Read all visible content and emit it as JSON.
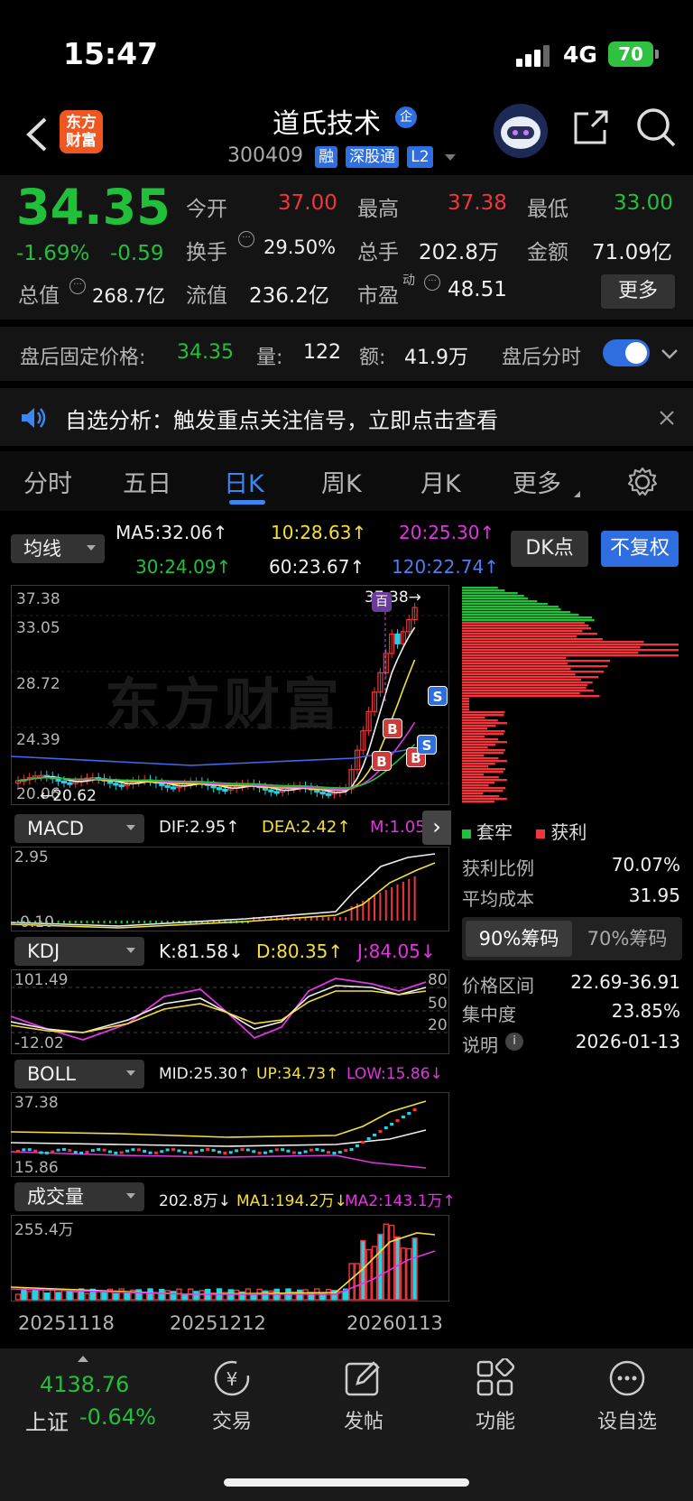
{
  "status": {
    "time": "15:47",
    "network": "4G",
    "battery": "70"
  },
  "header": {
    "logo_text": "东方\n财富",
    "title": "道氏技术",
    "title_badge": "企",
    "code": "300409",
    "tags": [
      "融",
      "深股通",
      "L2"
    ]
  },
  "quote": {
    "price": "34.35",
    "change_pct": "-1.69%",
    "change": "-0.59",
    "open_label": "今开",
    "open": "37.00",
    "high_label": "最高",
    "high": "37.38",
    "low_label": "最低",
    "low": "33.00",
    "turnover_label": "换手",
    "turnover": "29.50%",
    "volume_label": "总手",
    "volume": "202.8万",
    "amount_label": "金额",
    "amount": "71.09亿",
    "mktcap_label": "总值",
    "mktcap": "268.7亿",
    "float_label": "流值",
    "float": "236.2亿",
    "pe_label": "市盈",
    "pe_sup": "动",
    "pe": "48.51",
    "more_button": "更多"
  },
  "afterhours": {
    "label": "盘后固定价格:",
    "price": "34.35",
    "vol_label": "量:",
    "vol": "122",
    "amt_label": "额:",
    "amt": "41.9万",
    "toggle_label": "盘后分时",
    "toggle_on": true
  },
  "notice": {
    "text": "自选分析：触发重点关注信号，立即点击查看"
  },
  "tabs": [
    {
      "label": "分时"
    },
    {
      "label": "五日"
    },
    {
      "label": "日K"
    },
    {
      "label": "周K"
    },
    {
      "label": "月K"
    },
    {
      "label": "更多"
    }
  ],
  "active_tab": "日K",
  "ma": {
    "selector": "均线",
    "ma5": "MA5:32.06↑",
    "ma10": "10:28.63↑",
    "ma20": "20:25.30↑",
    "ma30": "30:24.09↑",
    "ma60": "60:23.67↑",
    "ma120": "120:22.74↑",
    "dk_button": "DK点",
    "fq_button": "不复权"
  },
  "kchart": {
    "y_labels": [
      "37.38",
      "33.05",
      "28.72",
      "24.39",
      "20.06"
    ],
    "max_annot": "37.38→",
    "min_annot": "←20.62",
    "watermark": "东方财富",
    "marker_top": "百",
    "b_markers": [
      "B",
      "B",
      "B"
    ],
    "s_markers": [
      "S",
      "S"
    ]
  },
  "macd": {
    "selector": "MACD",
    "dif": "DIF:2.95↑",
    "dea": "DEA:2.42↑",
    "m": "M:1.05↑",
    "y_top": "2.95",
    "y_bottom": "-0.10"
  },
  "kdj": {
    "selector": "KDJ",
    "k": "K:81.58↓",
    "d": "D:80.35↑",
    "j": "J:84.05↓",
    "y_top": "101.49",
    "y_bottom": "-12.02",
    "levels": [
      "80",
      "50",
      "20"
    ]
  },
  "boll": {
    "selector": "BOLL",
    "mid": "MID:25.30↑",
    "up": "UP:34.73↑",
    "low": "LOW:15.86↓",
    "y_top": "37.38",
    "y_bottom": "15.86"
  },
  "vol": {
    "selector": "成交量",
    "v": "202.8万↓",
    "ma1": "MA1:194.2万↓",
    "ma2": "MA2:143.1万↑",
    "y_top": "255.4万",
    "dates": [
      "20251118",
      "20251212",
      "20260113"
    ]
  },
  "chip": {
    "legend_trap": "套牢",
    "legend_profit": "获利",
    "profit_ratio_label": "获利比例",
    "profit_ratio": "70.07%",
    "avg_cost_label": "平均成本",
    "avg_cost": "31.95",
    "tab90": "90%筹码",
    "tab70": "70%筹码",
    "range_label": "价格区间",
    "range": "22.69-36.91",
    "conc_label": "集中度",
    "conc": "23.85%",
    "note_label": "说明",
    "date": "2026-01-13"
  },
  "bottom": {
    "index_value": "4138.76",
    "index_name": "上证",
    "index_change": "-0.64%",
    "items": [
      "交易",
      "发帖",
      "功能",
      "设自选"
    ]
  },
  "colors": {
    "up": "#f2353a",
    "down": "#22c03a",
    "cyan": "#21d3e6",
    "accent": "#2f6ee0"
  }
}
